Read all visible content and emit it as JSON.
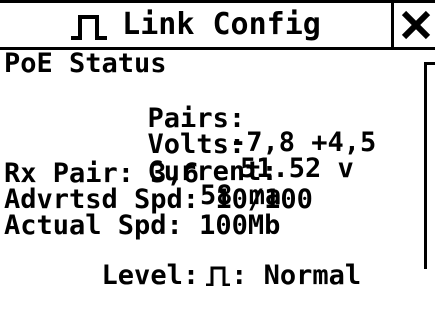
{
  "title": "Link Config",
  "title_icon": "pulse-waveform-icon",
  "close_icon": "close-x-icon",
  "poe": {
    "heading": "PoE Status",
    "pairs_label": "Pairs:",
    "pairs_value": "-7,8 +4,5",
    "volts_label": "Volts:",
    "volts_value": "51.52 v",
    "current_label": "Current:",
    "current_value": "58 ma"
  },
  "rx_pair": "Rx Pair: 3,6",
  "advertised_speed": "Advrtsd Spd: 10/100",
  "actual_speed": "Actual Spd: 100Mb",
  "level": {
    "label": "Level:",
    "icon": "pulse-waveform-icon",
    "value": ": Normal"
  },
  "colors": {
    "foreground": "#000000",
    "background": "#ffffff"
  }
}
